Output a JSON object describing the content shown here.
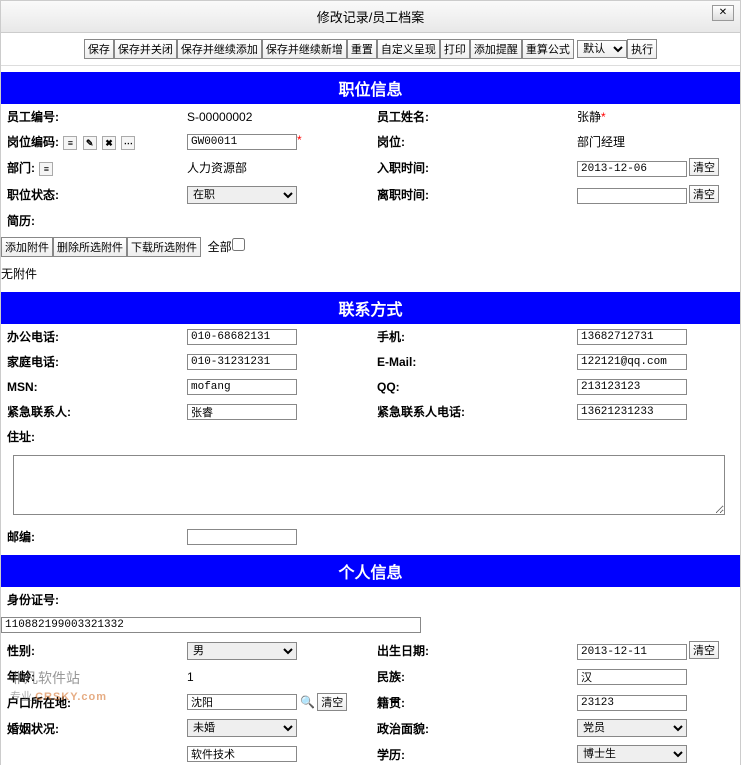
{
  "title": "修改记录/员工档案",
  "toolbar": {
    "save": "保存",
    "save_close": "保存并关闭",
    "save_continue_add": "保存并继续添加",
    "save_continue_new": "保存并继续新增",
    "reset": "重置",
    "custom_view": "自定义呈现",
    "print": "打印",
    "add_remind": "添加提醒",
    "recalc": "重算公式",
    "default_opt": "默认",
    "execute": "执行"
  },
  "sections": {
    "position": "职位信息",
    "contact": "联系方式",
    "personal": "个人信息"
  },
  "position": {
    "emp_id_label": "员工编号:",
    "emp_id": "S-00000002",
    "emp_name_label": "员工姓名:",
    "emp_name": "张静",
    "post_code_label": "岗位编码:",
    "post_code": "GW00011",
    "post_label": "岗位:",
    "post": "部门经理",
    "dept_label": "部门:",
    "dept": "人力资源部",
    "hire_date_label": "入职时间:",
    "hire_date": "2013-12-06",
    "status_label": "职位状态:",
    "status": "在职",
    "leave_date_label": "离职时间:",
    "leave_date": "",
    "resume_label": "简历:",
    "attach_add": "添加附件",
    "attach_del": "删除所选附件",
    "attach_download": "下载所选附件",
    "attach_all": "全部",
    "no_attach": "无附件",
    "clear_btn": "清空"
  },
  "contact": {
    "office_phone_label": "办公电话:",
    "office_phone": "010-68682131",
    "mobile_label": "手机:",
    "mobile": "13682712731",
    "home_phone_label": "家庭电话:",
    "home_phone": "010-31231231",
    "email_label": "E-Mail:",
    "email": "122121@qq.com",
    "msn_label": "MSN:",
    "msn": "mofang",
    "qq_label": "QQ:",
    "qq": "213123123",
    "emergency_contact_label": "紧急联系人:",
    "emergency_contact": "张睿",
    "emergency_phone_label": "紧急联系人电话:",
    "emergency_phone": "13621231233",
    "address_label": "住址:",
    "address": "",
    "zip_label": "邮编:",
    "zip": ""
  },
  "personal": {
    "idcard_label": "身份证号:",
    "idcard": "110882199003321332",
    "gender_label": "性别:",
    "gender": "男",
    "birth_label": "出生日期:",
    "birth": "2013-12-11",
    "age_label": "年龄:",
    "age": "1",
    "nation_label": "民族:",
    "nation": "汉",
    "household_label": "户口所在地:",
    "household": "沈阳",
    "native_label": "籍贯:",
    "native": "23123",
    "marital_label": "婚姻状况:",
    "marital": "未婚",
    "political_label": "政治面貌:",
    "political": "党员",
    "major_label": "",
    "major": "软件技术",
    "edu_label": "学历:",
    "edu": "博士生",
    "clear_btn": "清空"
  },
  "watermark": {
    "cn": "非凡软件站",
    "en": "CRSKY.com",
    "tag": "专业"
  }
}
